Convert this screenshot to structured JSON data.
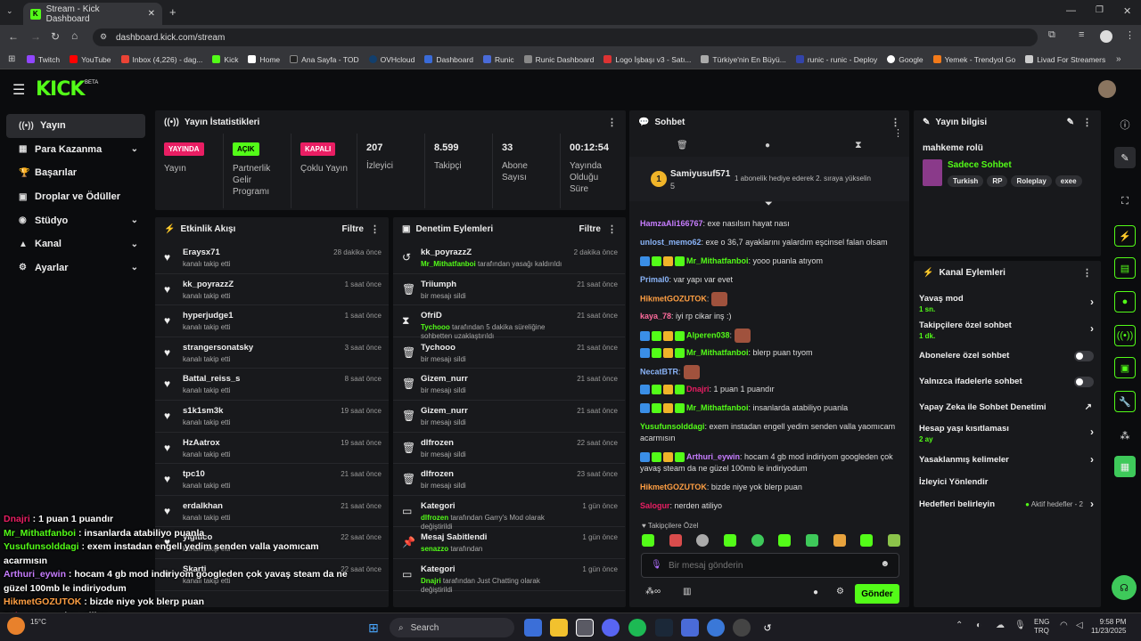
{
  "browser": {
    "tab_title": "Stream - Kick Dashboard",
    "url": "dashboard.kick.com/stream",
    "bookmarks": [
      "Twitch",
      "YouTube",
      "Inbox (4,226) - dag...",
      "Kick",
      "Home",
      "Ana Sayfa - TOD",
      "OVHcloud",
      "Dashboard",
      "Runic",
      "Runic Dashboard",
      "Logo İşbaşı v3 - Satı...",
      "Türkiye'nin En Büyü...",
      "runic - runic - Deploy",
      "Google",
      "Yemek - Trendyol Go",
      "Livad For Streamers"
    ]
  },
  "header": {
    "logo": "KICK",
    "logo_sup": "BETA"
  },
  "sidebar": {
    "items": [
      {
        "label": "Yayın",
        "icon": "broadcast-icon"
      },
      {
        "label": "Para Kazanma",
        "icon": "money-icon"
      },
      {
        "label": "Başarılar",
        "icon": "trophy-icon"
      },
      {
        "label": "Droplar ve Ödüller",
        "icon": "gift-icon"
      },
      {
        "label": "Stüdyo",
        "icon": "studio-icon"
      },
      {
        "label": "Kanal",
        "icon": "channel-icon"
      },
      {
        "label": "Ayarlar",
        "icon": "gear-icon"
      }
    ]
  },
  "stats": {
    "title": "Yayın İstatistikleri",
    "cells": [
      {
        "badge": "YAYINDA",
        "label": "Yayın",
        "color": "#e91e63"
      },
      {
        "badge": "AÇIK",
        "label": "Partnerlik Gelir Programı",
        "color": "#53fc18"
      },
      {
        "badge": "KAPALI",
        "label": "Çoklu Yayın",
        "color": "#e91e63"
      },
      {
        "value": "207",
        "label": "İzleyici"
      },
      {
        "value": "8.599",
        "label": "Takipçi"
      },
      {
        "value": "33",
        "label": "Abone Sayısı"
      },
      {
        "value": "00:12:54",
        "label": "Yayında Olduğu Süre"
      }
    ]
  },
  "activity": {
    "title": "Etkinlik Akışı",
    "filter": "Filtre",
    "items": [
      {
        "name": "Eraysx71",
        "sub": "kanalı takip etti",
        "time": "28 dakika önce"
      },
      {
        "name": "kk_poyrazzZ",
        "sub": "kanalı takip etti",
        "time": "1 saat önce"
      },
      {
        "name": "hyperjudge1",
        "sub": "kanalı takip etti",
        "time": "1 saat önce"
      },
      {
        "name": "strangersonatsky",
        "sub": "kanalı takip etti",
        "time": "3 saat önce"
      },
      {
        "name": "Battal_reiss_s",
        "sub": "kanalı takip etti",
        "time": "8 saat önce"
      },
      {
        "name": "s1k1sm3k",
        "sub": "kanalı takip etti",
        "time": "19 saat önce"
      },
      {
        "name": "HzAatrox",
        "sub": "kanalı takip etti",
        "time": "19 saat önce"
      },
      {
        "name": "tpc10",
        "sub": "kanalı takip etti",
        "time": "21 saat önce"
      },
      {
        "name": "erdalkhan",
        "sub": "kanalı takip etti",
        "time": "21 saat önce"
      },
      {
        "name": "yiğitico",
        "sub": "kanalı takip etti",
        "time": "22 saat önce"
      },
      {
        "name": "Skarti",
        "sub": "kanalı takip etti",
        "time": "22 saat önce"
      }
    ]
  },
  "moderation": {
    "title": "Denetim Eylemleri",
    "filter": "Filtre",
    "items": [
      {
        "icon": "undo-icon",
        "name": "kk_poyrazzZ",
        "actor": "Mr_Mithatfanboi",
        "sub": " tarafından yasağı kaldırıldı",
        "time": "2 dakika önce"
      },
      {
        "icon": "trash-icon",
        "name": "Triiumph",
        "actor": "",
        "sub": "bir mesajı sildi",
        "time": "21 saat önce"
      },
      {
        "icon": "hourglass-icon",
        "name": "OfriD",
        "actor": "Tychooo",
        "sub": " tarafından 5 dakika süreliğine sohbetten uzaklaştırıldı",
        "time": "21 saat önce"
      },
      {
        "icon": "trash-icon",
        "name": "Tychooo",
        "actor": "",
        "sub": "bir mesajı sildi",
        "time": "21 saat önce"
      },
      {
        "icon": "trash-icon",
        "name": "Gizem_nurr",
        "actor": "",
        "sub": "bir mesajı sildi",
        "time": "21 saat önce"
      },
      {
        "icon": "trash-icon",
        "name": "Gizem_nurr",
        "actor": "",
        "sub": "bir mesajı sildi",
        "time": "21 saat önce"
      },
      {
        "icon": "trash-icon",
        "name": "dlfrozen",
        "actor": "",
        "sub": "bir mesajı sildi",
        "time": "22 saat önce"
      },
      {
        "icon": "trash-icon",
        "name": "dlfrozen",
        "actor": "",
        "sub": "bir mesajı sildi",
        "time": "23 saat önce"
      },
      {
        "icon": "category-icon",
        "name": "Kategori",
        "actor": "dlfrozen",
        "sub": " tarafından Garry's Mod olarak değiştirildi",
        "time": "1 gün önce"
      },
      {
        "icon": "pin-icon",
        "name": "Mesaj Sabitlendi",
        "actor": "senazzo",
        "sub": " tarafından",
        "time": "1 gün önce"
      },
      {
        "icon": "category-icon",
        "name": "Kategori",
        "actor": "Dnajri",
        "sub": " tarafından Just Chatting olarak değiştirildi",
        "time": "1 gün önce"
      }
    ]
  },
  "chat": {
    "title": "Sohbet",
    "pinned_user": "Samiyusuf571",
    "pinned_count": "5",
    "pinned_text": "1 abonelik hediye ederek 2. sıraya yükselin",
    "messages": [
      {
        "user": "HamzaAli166767",
        "color": "#c77dff",
        "text": ": exe nasılsın hayat nası"
      },
      {
        "user": "unlost_memo62",
        "color": "#8ab4f8",
        "text": ": exe o 36,7 ayaklarını yalardım eşcinsel falan olsam"
      },
      {
        "user": "Mr_Mithatfanboi",
        "color": "#53fc18",
        "text": ": yooo puanla atıyom"
      },
      {
        "user": "Primal0",
        "color": "#8ab4f8",
        "text": ": var yapı var evet"
      },
      {
        "user": "HikmetGOZUTOK",
        "color": "#ff9f43",
        "text": ":"
      },
      {
        "user": "kaya_78",
        "color": "#ff6b9d",
        "text": ": iyi rp cikar inş :)"
      },
      {
        "user": "Alperen038",
        "color": "#53fc18",
        "text": ":"
      },
      {
        "user": "Mr_Mithatfanboi",
        "color": "#53fc18",
        "text": ": blerp puan tıyom"
      },
      {
        "user": "NecatBTR",
        "color": "#8ab4f8",
        "text": ":"
      },
      {
        "user": "Dnajri",
        "color": "#e91e63",
        "text": ": 1 puan 1 puandır"
      },
      {
        "user": "Mr_Mithatfanboi",
        "color": "#53fc18",
        "text": ": insanlarda atabiliyo puanla"
      },
      {
        "user": "Yusufunsolddagi",
        "color": "#53fc18",
        "text": ": exem instadan engell yedim senden valla yaomıcam acarmısın"
      },
      {
        "user": "Arthuri_eywin",
        "color": "#c77dff",
        "text": ": hocam 4 gb mod indiriyom googleden çok yavaş steam da ne güzel 100mb le indiriyodum"
      },
      {
        "user": "HikmetGOZUTOK",
        "color": "#ff9f43",
        "text": ": bizde niye yok blerp puan"
      },
      {
        "user": "Salogur",
        "color": "#e91e63",
        "text": ": nerden atiliyo"
      }
    ],
    "followers_only": "Takipçilere Özel",
    "input_placeholder": "Bir mesaj gönderin",
    "send_label": "Gönder"
  },
  "stream_info": {
    "title": "Yayın bilgisi",
    "stream_title": "mahkeme rolü",
    "category": "Sadece Sohbet",
    "tags": [
      "Turkish",
      "RP",
      "Roleplay",
      "exee"
    ]
  },
  "channel_actions": {
    "title": "Kanal Eylemleri",
    "items": [
      {
        "label": "Yavaş mod",
        "sub": "1 sn.",
        "control": "chevron"
      },
      {
        "label": "Takipçilere özel sohbet",
        "sub": "1 dk.",
        "control": "chevron"
      },
      {
        "label": "Abonelere özel sohbet",
        "sub": "",
        "control": "toggle"
      },
      {
        "label": "Yalnızca ifadelerle sohbet",
        "sub": "",
        "control": "toggle"
      },
      {
        "label": "Yapay Zeka ile Sohbet Denetimi",
        "sub": "",
        "control": "external"
      },
      {
        "label": "Hesap yaşı kısıtlaması",
        "sub": "2 ay",
        "control": "chevron"
      },
      {
        "label": "Yasaklanmış kelimeler",
        "sub": "",
        "control": "chevron"
      },
      {
        "label": "İzleyici Yönlendir",
        "sub": "",
        "control": "none"
      },
      {
        "label": "Hedefleri belirleyin",
        "sub": "",
        "control": "goal"
      }
    ],
    "goal_status": "Aktif hedefler - 2"
  },
  "overlay": {
    "lines": [
      {
        "user": "Dnajri",
        "color": "#e91e63",
        "text": " : 1 puan 1 puandır"
      },
      {
        "user": "Mr_Mithatfanboi",
        "color": "#53fc18",
        "text": " : insanlarda atabiliyo puanla"
      },
      {
        "user": "Yusufunsolddagi",
        "color": "#53fc18",
        "text": " : exem instadan engell yedim senden valla yaomıcam"
      },
      {
        "user": "",
        "color": "#fff",
        "text": "acarmısın"
      },
      {
        "user": "Arthuri_eywin",
        "color": "#c77dff",
        "text": " : hocam 4 gb mod indiriyom googleden çok yavaş steam da ne"
      },
      {
        "user": "",
        "color": "#fff",
        "text": "güzel 100mb le indiriyodum"
      },
      {
        "user": "HikmetGOZUTOK",
        "color": "#ff9f43",
        "text": " : bizde niye yok blerp puan"
      },
      {
        "user": "Salogur",
        "color": "#e91e63",
        "text": " : nerden atiliyo"
      }
    ]
  },
  "taskbar": {
    "weather": "15°C",
    "search": "Search",
    "lang": "ENG",
    "lang2": "TRQ",
    "time": "9:58 PM",
    "date": "11/23/2025"
  }
}
